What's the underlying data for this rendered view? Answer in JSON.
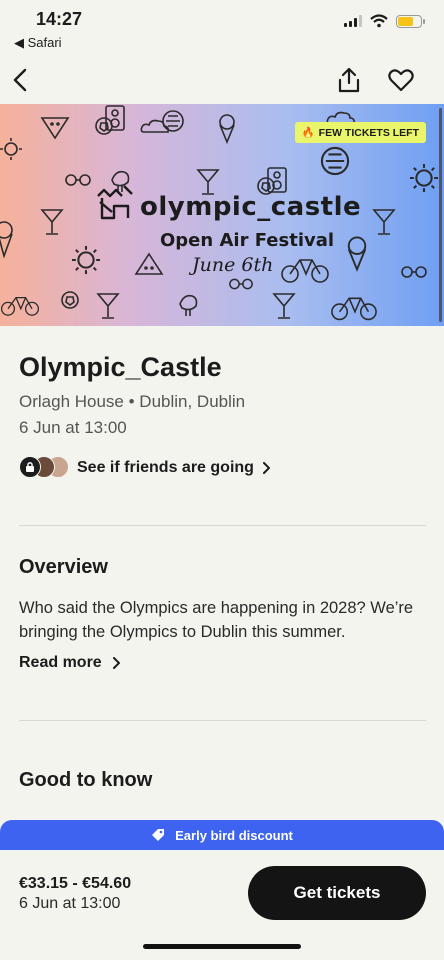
{
  "status_bar": {
    "time": "14:27",
    "back_app": "Safari",
    "battery_color": "#f5c416"
  },
  "nav": {
    "back_icon": "chevron-left-icon",
    "share_icon": "share-icon",
    "favorite_icon": "heart-icon"
  },
  "banner": {
    "badge": "FEW TICKETS LEFT",
    "brand_title": "olympic_castle",
    "brand_subtitle": "Open Air Festival",
    "brand_date": "June 6th",
    "gradient_start": "#f6b19b",
    "gradient_end": "#6f9ff2",
    "badge_color": "#e9f56a"
  },
  "event": {
    "title": "Olympic_Castle",
    "venue": "Orlagh House • Dublin, Dublin",
    "datetime": "6 Jun at 13:00",
    "friends_label": "See if friends are going"
  },
  "overview": {
    "heading": "Overview",
    "text": "Who said the Olympics are happening in 2028? We’re bringing the Olympics to Dublin this summer.",
    "read_more": "Read more"
  },
  "good_to_know": {
    "heading": "Good to know"
  },
  "footer": {
    "promo": "Early bird discount",
    "promo_color": "#3d63f0",
    "price": "€33.15 - €54.60",
    "date": "6 Jun at 13:00",
    "cta": "Get tickets"
  }
}
